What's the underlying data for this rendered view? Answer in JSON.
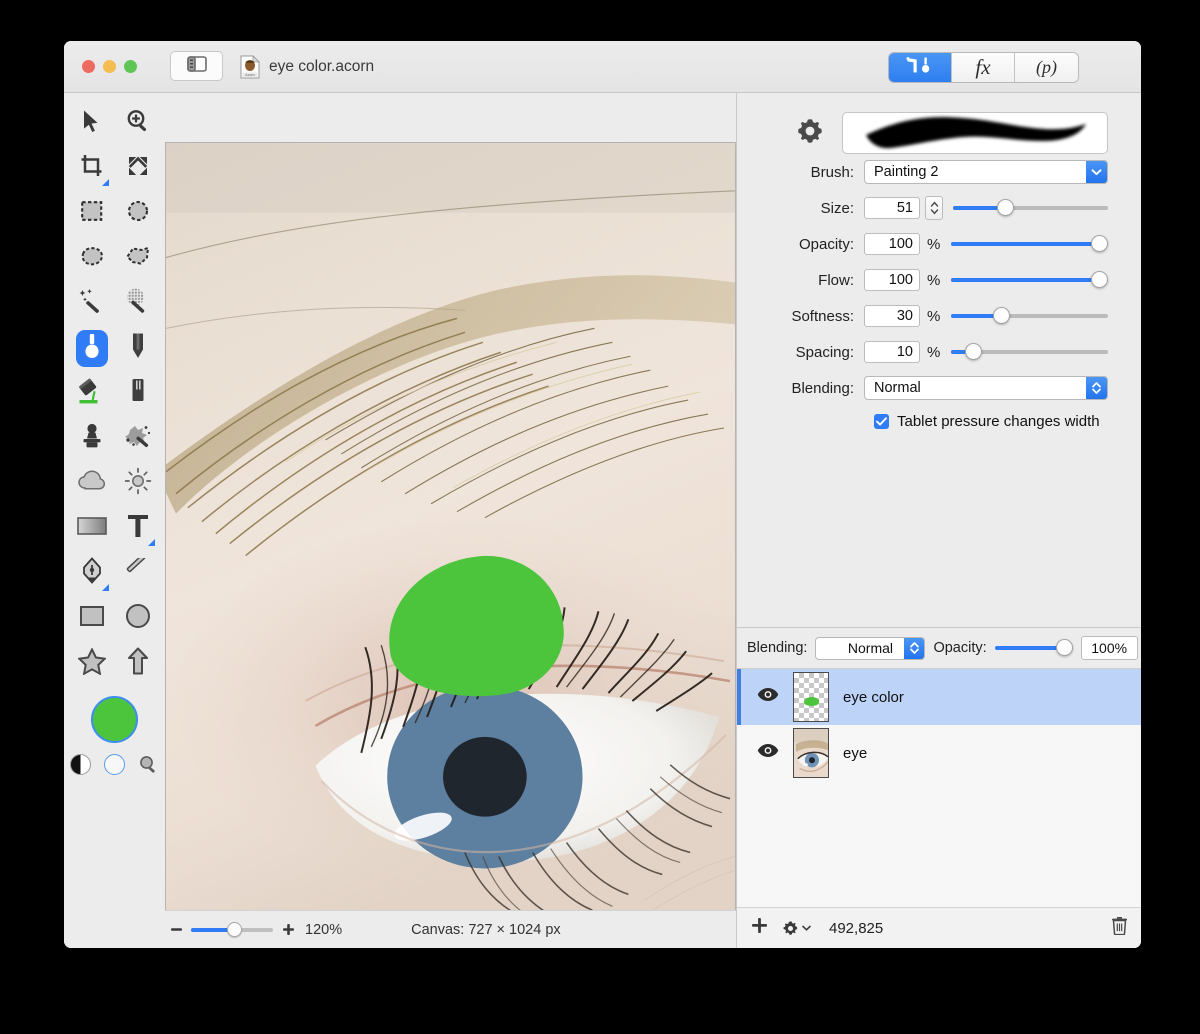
{
  "window": {
    "title": "eye color.acorn",
    "doc_icon": "acorn-document-icon",
    "traffic_lights": [
      "close",
      "minimize",
      "zoom"
    ],
    "sidebar_toggle_icon": "sidebar-toggle-icon"
  },
  "inspector_tabs": [
    {
      "id": "tools",
      "icon": "hammer-brush-icon",
      "label": "",
      "active": true
    },
    {
      "id": "fx",
      "icon": "",
      "label": "fx",
      "active": false
    },
    {
      "id": "presets",
      "icon": "",
      "label": "(p)",
      "active": false
    }
  ],
  "tools": {
    "items": [
      {
        "name": "move-tool",
        "icon": "arrow-cursor-icon",
        "selected": false,
        "badge": false
      },
      {
        "name": "zoom-tool",
        "icon": "magnifier-plus-icon",
        "selected": false,
        "badge": false
      },
      {
        "name": "crop-tool",
        "icon": "crop-icon",
        "selected": false,
        "badge": true
      },
      {
        "name": "transform-tool",
        "icon": "four-arrows-icon",
        "selected": false,
        "badge": false
      },
      {
        "name": "rectangular-select-tool",
        "icon": "dashed-square-icon",
        "selected": false,
        "badge": false
      },
      {
        "name": "elliptical-select-tool",
        "icon": "dashed-circle-icon",
        "selected": false,
        "badge": false
      },
      {
        "name": "lasso-select-tool",
        "icon": "lasso-icon",
        "selected": false,
        "badge": false
      },
      {
        "name": "polygon-select-tool",
        "icon": "polygon-lasso-icon",
        "selected": false,
        "badge": false
      },
      {
        "name": "magic-wand-tool",
        "icon": "magic-wand-icon",
        "selected": false,
        "badge": false
      },
      {
        "name": "instant-alpha-tool",
        "icon": "magic-wand-halftone-icon",
        "selected": false,
        "badge": false
      },
      {
        "name": "paint-brush-tool",
        "icon": "paintbrush-icon",
        "selected": true,
        "badge": false
      },
      {
        "name": "pencil-tool",
        "icon": "pencil-icon",
        "selected": false,
        "badge": false
      },
      {
        "name": "paint-bucket-tool",
        "icon": "paint-bucket-icon",
        "selected": false,
        "badge": false
      },
      {
        "name": "eraser-tool",
        "icon": "eraser-icon",
        "selected": false,
        "badge": false
      },
      {
        "name": "clone-stamp-tool",
        "icon": "clone-stamp-icon",
        "selected": false,
        "badge": false
      },
      {
        "name": "smudge-tool",
        "icon": "smudge-splatter-icon",
        "selected": false,
        "badge": false
      },
      {
        "name": "blur-tool",
        "icon": "cloud-blur-icon",
        "selected": false,
        "badge": false
      },
      {
        "name": "dodge-burn-tool",
        "icon": "sun-dodge-icon",
        "selected": false,
        "badge": false
      },
      {
        "name": "gradient-tool",
        "icon": "gradient-rectangle-icon",
        "selected": false,
        "badge": false
      },
      {
        "name": "text-tool",
        "icon": "text-t-icon",
        "selected": false,
        "badge": true
      },
      {
        "name": "bezier-pen-tool",
        "icon": "pen-nib-icon",
        "selected": false,
        "badge": true
      },
      {
        "name": "line-tool",
        "icon": "line-icon",
        "selected": false,
        "badge": false
      },
      {
        "name": "rectangle-shape-tool",
        "icon": "rectangle-icon",
        "selected": false,
        "badge": false
      },
      {
        "name": "ellipse-shape-tool",
        "icon": "ellipse-icon",
        "selected": false,
        "badge": false
      },
      {
        "name": "star-shape-tool",
        "icon": "star-icon",
        "selected": false,
        "badge": false
      },
      {
        "name": "arrow-shape-tool",
        "icon": "arrow-up-shape-icon",
        "selected": false,
        "badge": false
      }
    ],
    "foreground_color": "#4cc43c",
    "swatch_ring_color": "#3d8ef0",
    "mini_swatches": [
      {
        "name": "default-colors-swatch",
        "icon": "yin-yang-icon"
      },
      {
        "name": "no-color-swatch",
        "icon": "empty-circle-icon"
      },
      {
        "name": "color-picker-swatch",
        "icon": "magnifier-icon"
      }
    ]
  },
  "brush_panel": {
    "gear_icon": "gear-icon",
    "preview_alt": "brush-stroke-preview",
    "brush": {
      "label": "Brush:",
      "value": "Painting 2"
    },
    "size": {
      "label": "Size:",
      "value": "51",
      "unit": "",
      "fill_pct": 32
    },
    "opacity": {
      "label": "Opacity:",
      "value": "100",
      "unit": "%",
      "fill_pct": 100
    },
    "flow": {
      "label": "Flow:",
      "value": "100",
      "unit": "%",
      "fill_pct": 100
    },
    "softness": {
      "label": "Softness:",
      "value": "30",
      "unit": "%",
      "fill_pct": 30
    },
    "spacing": {
      "label": "Spacing:",
      "value": "10",
      "unit": "%",
      "fill_pct": 10
    },
    "blending": {
      "label": "Blending:",
      "value": "Normal"
    },
    "tablet_pressure": {
      "label": "Tablet pressure changes width",
      "checked": true
    }
  },
  "layers_panel": {
    "blending_label": "Blending:",
    "blending_value": "Normal",
    "opacity_label": "Opacity:",
    "opacity_value": "100%",
    "opacity_fill_pct": 100,
    "rows": [
      {
        "name": "eye color",
        "visible": true,
        "selected": true,
        "thumb": "transparent-green-blob-thumbnail"
      },
      {
        "name": "eye",
        "visible": true,
        "selected": false,
        "thumb": "eye-photo-thumbnail"
      }
    ],
    "footer": {
      "add_icon": "plus-icon",
      "settings_icon": "gear-dropdown-icon",
      "count": "492,825",
      "delete_icon": "trash-icon"
    }
  },
  "status_bar": {
    "zoom_out_icon": "minus-icon",
    "zoom_in_icon": "plus-icon",
    "zoom_value": "120%",
    "zoom_fill_pct": 53,
    "canvas_label": "Canvas: 727 × 1024 px"
  },
  "canvas": {
    "image_description": "close-up photograph of a human eye with eyebrow and eyelashes",
    "painted_color": "#4cc43c"
  }
}
